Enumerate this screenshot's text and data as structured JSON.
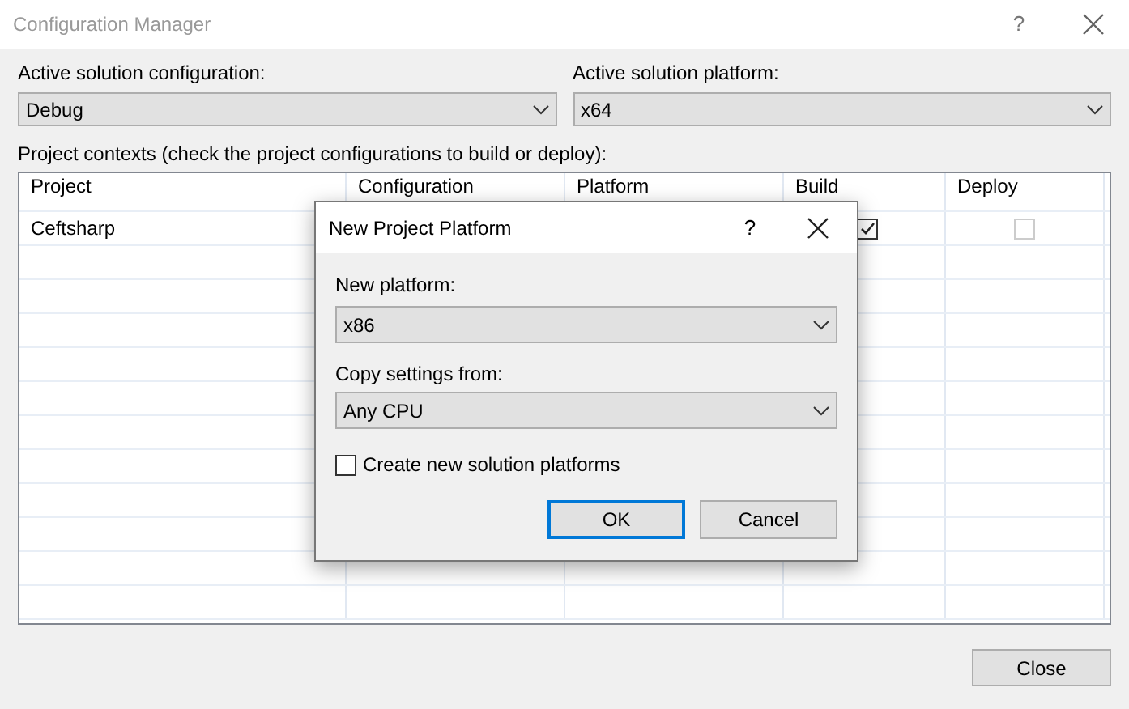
{
  "window": {
    "title": "Configuration Manager",
    "help": "?"
  },
  "active_configuration": {
    "label": "Active solution configuration:",
    "value": "Debug"
  },
  "active_platform": {
    "label": "Active solution platform:",
    "value": "x64"
  },
  "contexts_label": "Project contexts (check the project configurations to build or deploy):",
  "table": {
    "columns": [
      "Project",
      "Configuration",
      "Platform",
      "Build",
      "Deploy"
    ],
    "rows": [
      {
        "project": "Ceftsharp",
        "build": true,
        "deploy": false,
        "deploy_disabled": true
      }
    ]
  },
  "dialog": {
    "title": "New Project Platform",
    "help": "?",
    "new_platform": {
      "label": "New platform:",
      "value": "x86"
    },
    "copy_from": {
      "label": "Copy settings from:",
      "value": "Any CPU"
    },
    "create_solution_platforms": {
      "label": "Create new solution platforms",
      "checked": false
    },
    "buttons": [
      {
        "label": "OK",
        "default": true
      },
      {
        "label": "Cancel",
        "default": false
      }
    ]
  },
  "close_button": "Close"
}
